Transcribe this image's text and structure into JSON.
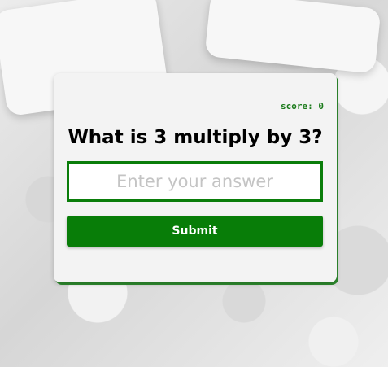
{
  "quiz": {
    "score_label": "score:",
    "score_value": "0",
    "question": "What is 3 multiply by 3?",
    "answer_placeholder": "Enter your answer",
    "answer_value": "",
    "submit_label": "Submit"
  },
  "colors": {
    "accent": "#087d08",
    "score_text": "#1a7a1a",
    "card_background": "#f3f3f3"
  }
}
